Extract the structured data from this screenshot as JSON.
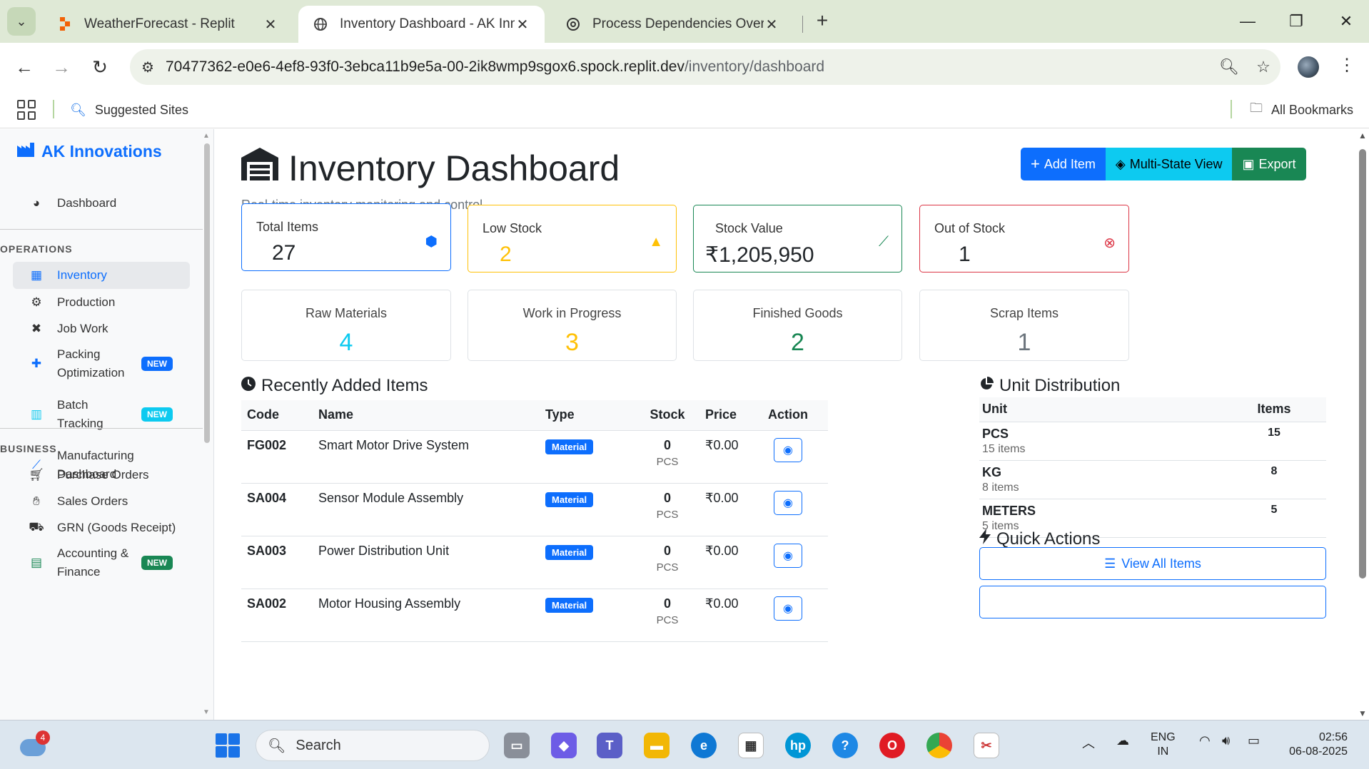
{
  "browser": {
    "tabs": [
      {
        "title": "WeatherForecast - Replit",
        "active": false
      },
      {
        "title": "Inventory Dashboard - AK Innovations",
        "active": true
      },
      {
        "title": "Process Dependencies Overview",
        "active": false
      }
    ],
    "url_host": "70477362-e0e6-4ef8-93f0-3ebca11b9e5a-00-2ik8wmp9sgox6.spock.replit.dev",
    "url_path": "/inventory/dashboard",
    "bookmarks": {
      "suggested": "Suggested Sites",
      "all": "All Bookmarks"
    }
  },
  "sidebar": {
    "brand": "AK Innovations",
    "dashboard": "Dashboard",
    "operations_header": "OPERATIONS",
    "operations": [
      {
        "label": "Inventory",
        "icon": "boxes-icon",
        "active": true
      },
      {
        "label": "Production",
        "icon": "gears-icon"
      },
      {
        "label": "Job Work",
        "icon": "tools-icon"
      },
      {
        "label": "Packing Optimization",
        "icon": "puzzle-icon",
        "badge": "NEW"
      },
      {
        "label": "Batch Tracking",
        "icon": "barcode-icon",
        "badge": "NEW"
      },
      {
        "label": "Manufacturing Dashboard",
        "icon": "chart-line-icon"
      }
    ],
    "business_header": "BUSINESS",
    "business": [
      {
        "label": "Purchase Orders",
        "icon": "cart-icon"
      },
      {
        "label": "Sales Orders",
        "icon": "handshake-icon"
      },
      {
        "label": "GRN (Goods Receipt)",
        "icon": "truck-icon"
      },
      {
        "label": "Accounting & Finance",
        "icon": "calculator-icon",
        "badge": "NEW"
      }
    ]
  },
  "header": {
    "title": "Inventory Dashboard",
    "subtitle": "Real-time inventory monitoring and control",
    "buttons": {
      "add": "Add Item",
      "multi": "Multi-State View",
      "export": "Export"
    }
  },
  "stats": [
    {
      "label": "Total Items",
      "value": "27",
      "icon": "cubes-icon",
      "color": "#0d6efd"
    },
    {
      "label": "Low Stock",
      "value": "2",
      "icon": "warning-icon",
      "color": "#ffc107"
    },
    {
      "label": "Stock Value",
      "value": "₹1,205,950",
      "icon": "chart-line-icon",
      "color": "#198754"
    },
    {
      "label": "Out of Stock",
      "value": "1",
      "icon": "times-circle-icon",
      "color": "#dc3545"
    }
  ],
  "categories": [
    {
      "label": "Raw Materials",
      "value": "4",
      "color": "#0dcaf0"
    },
    {
      "label": "Work in Progress",
      "value": "3",
      "color": "#ffc107"
    },
    {
      "label": "Finished Goods",
      "value": "2",
      "color": "#198754"
    },
    {
      "label": "Scrap Items",
      "value": "1",
      "color": "#6c757d"
    }
  ],
  "recent": {
    "title": "Recently Added Items",
    "columns": [
      "Code",
      "Name",
      "Type",
      "Stock",
      "Price",
      "Action"
    ],
    "rows": [
      {
        "code": "FG002",
        "name": "Smart Motor Drive System",
        "type": "Material",
        "stock": "0",
        "unit": "PCS",
        "price": "₹0.00"
      },
      {
        "code": "SA004",
        "name": "Sensor Module Assembly",
        "type": "Material",
        "stock": "0",
        "unit": "PCS",
        "price": "₹0.00"
      },
      {
        "code": "SA003",
        "name": "Power Distribution Unit",
        "type": "Material",
        "stock": "0",
        "unit": "PCS",
        "price": "₹0.00"
      },
      {
        "code": "SA002",
        "name": "Motor Housing Assembly",
        "type": "Material",
        "stock": "0",
        "unit": "PCS",
        "price": "₹0.00"
      }
    ]
  },
  "units": {
    "title": "Unit Distribution",
    "columns": [
      "Unit",
      "Items"
    ],
    "rows": [
      {
        "unit": "PCS",
        "sub": "15 items",
        "count": "15"
      },
      {
        "unit": "KG",
        "sub": "8 items",
        "count": "8"
      },
      {
        "unit": "METERS",
        "sub": "5 items",
        "count": "5"
      }
    ]
  },
  "quick_actions": {
    "title": "Quick Actions",
    "view_all": "View All Items"
  },
  "taskbar": {
    "search": "Search",
    "weather_badge": "4",
    "lang1": "ENG",
    "lang2": "IN",
    "time": "02:56",
    "date": "06-08-2025"
  }
}
